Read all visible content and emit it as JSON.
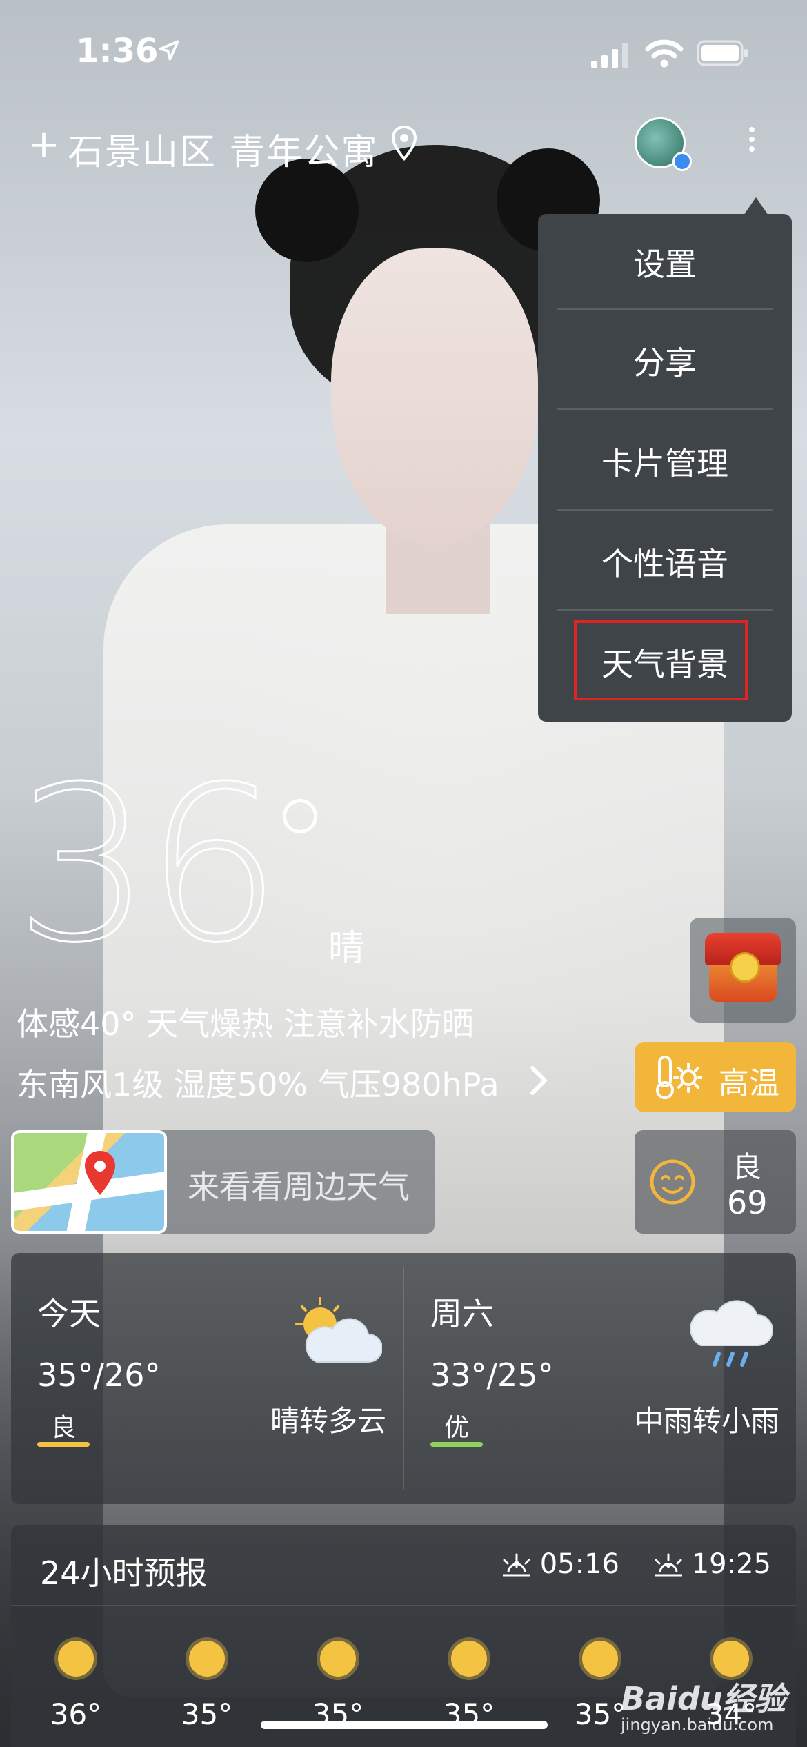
{
  "status_bar": {
    "time": "1:36"
  },
  "header": {
    "location": "石景山区 青年公寓"
  },
  "menu": {
    "items": [
      "设置",
      "分享",
      "卡片管理",
      "个性语音",
      "天气背景"
    ]
  },
  "current": {
    "temperature": "36",
    "condition": "晴",
    "feels_line": "体感40° 天气燥热 注意补水防晒",
    "wind_line": "东南风1级 湿度50% 气压980hPa"
  },
  "alert": {
    "label": "高温",
    "color": "#f2b63a"
  },
  "map_card": {
    "label": "来看看周边天气"
  },
  "aqi": {
    "level": "良",
    "value": "69"
  },
  "forecast": [
    {
      "day": "今天",
      "temp": "35°/26°",
      "aqi": "良",
      "aqi_color": "#f5c342",
      "desc": "晴转多云",
      "icon": "sun-cloud-icon"
    },
    {
      "day": "周六",
      "temp": "33°/25°",
      "aqi": "优",
      "aqi_color": "#8fd35c",
      "desc": "中雨转小雨",
      "icon": "rain-cloud-icon"
    }
  ],
  "hourly": {
    "title": "24小时预报",
    "sunrise": "05:16",
    "sunset": "19:25",
    "temps": [
      "36°",
      "35°",
      "35°",
      "35°",
      "35°",
      "34°"
    ]
  },
  "watermark": {
    "main": "Baidu经验",
    "sub": "jingyan.baidu.com"
  }
}
